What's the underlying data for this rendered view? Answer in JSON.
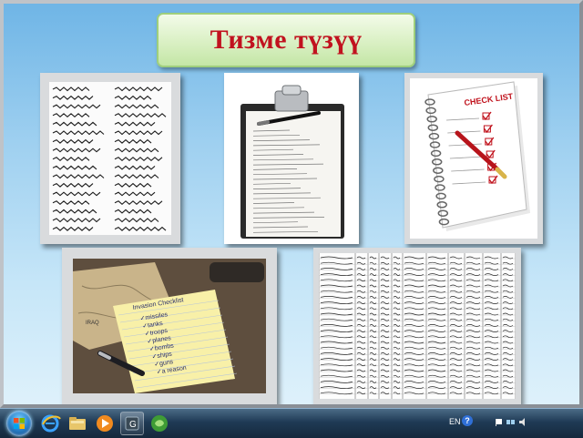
{
  "slide": {
    "title": "Тизме түзүү",
    "title_color": "#c1121f",
    "background_color": "#9fd0f0"
  },
  "images": [
    {
      "name": "handwritten-name-list"
    },
    {
      "name": "clipboard-with-list"
    },
    {
      "name": "checklist-notebook"
    },
    {
      "name": "invasion-checklist-notepad"
    },
    {
      "name": "handwritten-ledger-table"
    }
  ],
  "notepad": {
    "heading": "Invasion Checklist",
    "items": [
      "missiles",
      "tanks",
      "troops",
      "planes",
      "bombs",
      "ships",
      "guns",
      "a reason"
    ],
    "map_label": "IRAQ"
  },
  "notebook": {
    "heading": "CHECK LIST"
  },
  "taskbar": {
    "language": "EN",
    "help": "?",
    "icons": [
      "start-orb-icon",
      "internet-explorer-icon",
      "file-explorer-icon",
      "media-player-icon",
      "app-icon",
      "browser-icon"
    ]
  }
}
